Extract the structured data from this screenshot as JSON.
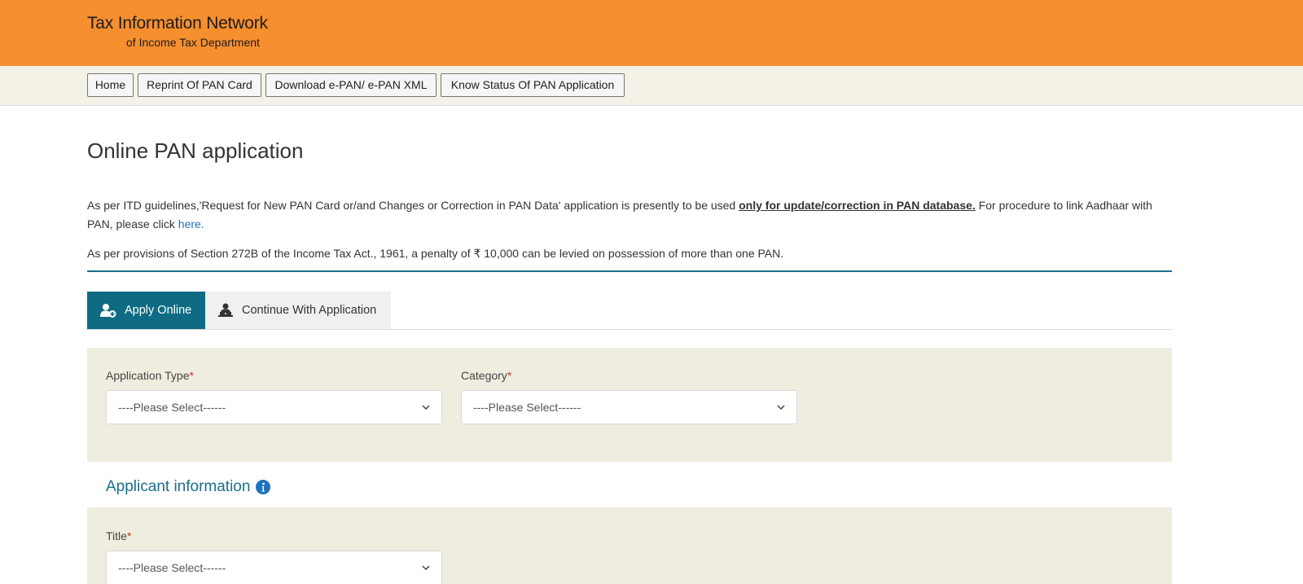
{
  "header": {
    "title": "Tax Information Network",
    "subtitle": "of Income Tax Department"
  },
  "nav": {
    "items": [
      {
        "label": "Home"
      },
      {
        "label": "Reprint Of PAN Card"
      },
      {
        "label": "Download e-PAN/ e-PAN XML"
      },
      {
        "label": "Know Status Of PAN Application"
      }
    ]
  },
  "page": {
    "title": "Online PAN application",
    "para1_text": "As per ITD guidelines,'Request for New PAN Card or/and Changes or Correction in PAN Data' application is presently to be used ",
    "para1_bold": "only for update/correction in PAN database.",
    "para1_after": " For procedure to link Aadhaar with PAN, please click ",
    "para1_link": "here.",
    "para2": "As per provisions of Section 272B of the Income Tax Act., 1961, a penalty of ₹ 10,000 can be levied on possession of more than one PAN."
  },
  "tabs": {
    "apply_online": "Apply Online",
    "continue": "Continue With Application"
  },
  "form": {
    "application_type": {
      "label": "Application Type",
      "required": "*",
      "value": "----Please Select------"
    },
    "category": {
      "label": "Category",
      "required": "*",
      "value": "----Please Select------"
    },
    "applicant_info_title": "Applicant information",
    "title_field": {
      "label": "Title",
      "required": "*",
      "value": "----Please Select------"
    }
  },
  "colors": {
    "header_bg": "#f68f2e",
    "nav_bg": "#f4f2e7",
    "accent": "#0f6b84",
    "panel_bg": "#efede0",
    "link": "#1e73be",
    "required": "#c0392b"
  },
  "icons": {
    "apply_online": "user-plus-icon",
    "continue": "user-laptop-icon",
    "info": "info-circle-icon",
    "select_arrow": "chevron-down-icon"
  }
}
